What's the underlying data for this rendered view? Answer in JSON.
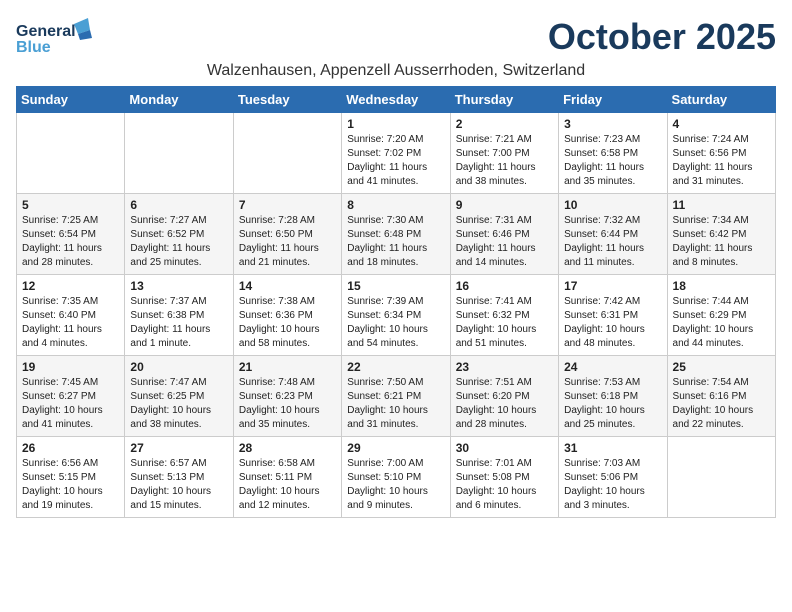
{
  "header": {
    "logo_line1": "General",
    "logo_line2": "Blue",
    "month_title": "October 2025",
    "subtitle": "Walzenhausen, Appenzell Ausserrhoden, Switzerland"
  },
  "weekdays": [
    "Sunday",
    "Monday",
    "Tuesday",
    "Wednesday",
    "Thursday",
    "Friday",
    "Saturday"
  ],
  "weeks": [
    [
      {
        "day": "",
        "info": ""
      },
      {
        "day": "",
        "info": ""
      },
      {
        "day": "",
        "info": ""
      },
      {
        "day": "1",
        "info": "Sunrise: 7:20 AM\nSunset: 7:02 PM\nDaylight: 11 hours\nand 41 minutes."
      },
      {
        "day": "2",
        "info": "Sunrise: 7:21 AM\nSunset: 7:00 PM\nDaylight: 11 hours\nand 38 minutes."
      },
      {
        "day": "3",
        "info": "Sunrise: 7:23 AM\nSunset: 6:58 PM\nDaylight: 11 hours\nand 35 minutes."
      },
      {
        "day": "4",
        "info": "Sunrise: 7:24 AM\nSunset: 6:56 PM\nDaylight: 11 hours\nand 31 minutes."
      }
    ],
    [
      {
        "day": "5",
        "info": "Sunrise: 7:25 AM\nSunset: 6:54 PM\nDaylight: 11 hours\nand 28 minutes."
      },
      {
        "day": "6",
        "info": "Sunrise: 7:27 AM\nSunset: 6:52 PM\nDaylight: 11 hours\nand 25 minutes."
      },
      {
        "day": "7",
        "info": "Sunrise: 7:28 AM\nSunset: 6:50 PM\nDaylight: 11 hours\nand 21 minutes."
      },
      {
        "day": "8",
        "info": "Sunrise: 7:30 AM\nSunset: 6:48 PM\nDaylight: 11 hours\nand 18 minutes."
      },
      {
        "day": "9",
        "info": "Sunrise: 7:31 AM\nSunset: 6:46 PM\nDaylight: 11 hours\nand 14 minutes."
      },
      {
        "day": "10",
        "info": "Sunrise: 7:32 AM\nSunset: 6:44 PM\nDaylight: 11 hours\nand 11 minutes."
      },
      {
        "day": "11",
        "info": "Sunrise: 7:34 AM\nSunset: 6:42 PM\nDaylight: 11 hours\nand 8 minutes."
      }
    ],
    [
      {
        "day": "12",
        "info": "Sunrise: 7:35 AM\nSunset: 6:40 PM\nDaylight: 11 hours\nand 4 minutes."
      },
      {
        "day": "13",
        "info": "Sunrise: 7:37 AM\nSunset: 6:38 PM\nDaylight: 11 hours\nand 1 minute."
      },
      {
        "day": "14",
        "info": "Sunrise: 7:38 AM\nSunset: 6:36 PM\nDaylight: 10 hours\nand 58 minutes."
      },
      {
        "day": "15",
        "info": "Sunrise: 7:39 AM\nSunset: 6:34 PM\nDaylight: 10 hours\nand 54 minutes."
      },
      {
        "day": "16",
        "info": "Sunrise: 7:41 AM\nSunset: 6:32 PM\nDaylight: 10 hours\nand 51 minutes."
      },
      {
        "day": "17",
        "info": "Sunrise: 7:42 AM\nSunset: 6:31 PM\nDaylight: 10 hours\nand 48 minutes."
      },
      {
        "day": "18",
        "info": "Sunrise: 7:44 AM\nSunset: 6:29 PM\nDaylight: 10 hours\nand 44 minutes."
      }
    ],
    [
      {
        "day": "19",
        "info": "Sunrise: 7:45 AM\nSunset: 6:27 PM\nDaylight: 10 hours\nand 41 minutes."
      },
      {
        "day": "20",
        "info": "Sunrise: 7:47 AM\nSunset: 6:25 PM\nDaylight: 10 hours\nand 38 minutes."
      },
      {
        "day": "21",
        "info": "Sunrise: 7:48 AM\nSunset: 6:23 PM\nDaylight: 10 hours\nand 35 minutes."
      },
      {
        "day": "22",
        "info": "Sunrise: 7:50 AM\nSunset: 6:21 PM\nDaylight: 10 hours\nand 31 minutes."
      },
      {
        "day": "23",
        "info": "Sunrise: 7:51 AM\nSunset: 6:20 PM\nDaylight: 10 hours\nand 28 minutes."
      },
      {
        "day": "24",
        "info": "Sunrise: 7:53 AM\nSunset: 6:18 PM\nDaylight: 10 hours\nand 25 minutes."
      },
      {
        "day": "25",
        "info": "Sunrise: 7:54 AM\nSunset: 6:16 PM\nDaylight: 10 hours\nand 22 minutes."
      }
    ],
    [
      {
        "day": "26",
        "info": "Sunrise: 6:56 AM\nSunset: 5:15 PM\nDaylight: 10 hours\nand 19 minutes."
      },
      {
        "day": "27",
        "info": "Sunrise: 6:57 AM\nSunset: 5:13 PM\nDaylight: 10 hours\nand 15 minutes."
      },
      {
        "day": "28",
        "info": "Sunrise: 6:58 AM\nSunset: 5:11 PM\nDaylight: 10 hours\nand 12 minutes."
      },
      {
        "day": "29",
        "info": "Sunrise: 7:00 AM\nSunset: 5:10 PM\nDaylight: 10 hours\nand 9 minutes."
      },
      {
        "day": "30",
        "info": "Sunrise: 7:01 AM\nSunset: 5:08 PM\nDaylight: 10 hours\nand 6 minutes."
      },
      {
        "day": "31",
        "info": "Sunrise: 7:03 AM\nSunset: 5:06 PM\nDaylight: 10 hours\nand 3 minutes."
      },
      {
        "day": "",
        "info": ""
      }
    ]
  ]
}
